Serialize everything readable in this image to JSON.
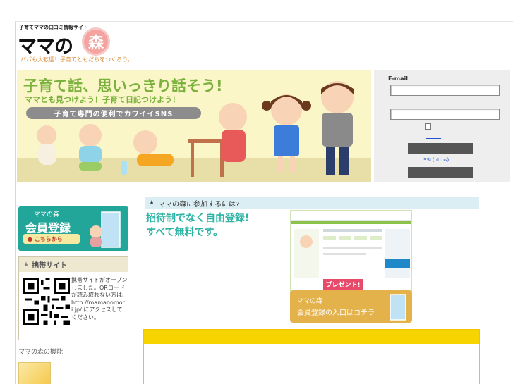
{
  "header": {
    "site_tagline": "子育てママの口コミ情報サイト",
    "logo_text": "ママの",
    "logo_kanji": "森",
    "sub_tagline": "パパも大歓迎！子育てともだちをつくろう。"
  },
  "banner": {
    "headline": "子育て話、思いっきり話そう!",
    "subheadline": "ママとも見つけよう！子育て日記つけよう！",
    "pill": "子育て専門の便利でカワイイSNS"
  },
  "login": {
    "email_label": "E-mail",
    "email_value": "",
    "password_value": "",
    "link_text": "______",
    "ssl_label": "SSL(https)"
  },
  "register": {
    "small": "ママの森",
    "big": "会員登録",
    "cta": "● こちらから"
  },
  "mobile": {
    "title": "携帯サイト",
    "text": "携帯サイトがオープンしました。QRコードが読み取れない方は、http://mamanomori.jp/ にアクセスしてください。"
  },
  "features": {
    "title": "ママの森の機能"
  },
  "join": {
    "bar_title": "ママの森に参加するには?",
    "line1": "招待制でなく自由登録!",
    "line2": "すべて無料です。",
    "present_label": "プレゼント!",
    "entry_small": "ママの森",
    "entry_big": "会員登録の入口はコチラ"
  },
  "colors": {
    "accent_green": "#7ab13c",
    "teal": "#23a69a",
    "yellow": "#f7d300",
    "banner_bg": "#faf6c8"
  }
}
